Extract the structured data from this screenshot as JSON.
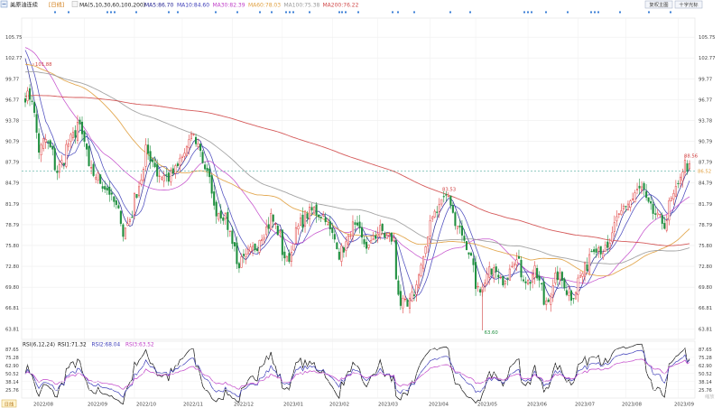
{
  "header": {
    "name": "美原油连续",
    "period_tag": "[日线]",
    "ma_params": "MA(5,10,30,60,100,200)",
    "ma_values": [
      {
        "label": "MA5:86.70",
        "color": "#1f1f8f"
      },
      {
        "label": "MA10:84.60",
        "color": "#3b3bb8"
      },
      {
        "label": "MA30:82.39",
        "color": "#c040c8"
      },
      {
        "label": "MA60:78.03",
        "color": "#e0a040"
      },
      {
        "label": "MA100:75.38",
        "color": "#9a9a9a"
      },
      {
        "label": "MA200:76.22",
        "color": "#d04848"
      }
    ],
    "buttons": [
      "复权主图",
      "十字光标"
    ]
  },
  "y_ticks": [
    "105.75",
    "102.77",
    "99.77",
    "96.77",
    "93.78",
    "90.79",
    "87.79",
    "84.79",
    "81.79",
    "78.79",
    "75.80",
    "72.80",
    "69.80",
    "66.81",
    "63.81"
  ],
  "rsi_ticks": [
    "87.65",
    "75.28",
    "62.90",
    "50.52",
    "38.14",
    "25.76"
  ],
  "x_ticks": [
    "2022/08",
    "2022/09",
    "2022/10",
    "2022/11",
    "2022/12",
    "2023/01",
    "2023/02",
    "2023/03",
    "2023/04",
    "2023/05",
    "2023/06",
    "2023/07",
    "2023/08",
    "2023/09"
  ],
  "annotations": {
    "high_start": "101.88",
    "high_mid": "83.53",
    "low": "63.60",
    "high_end": "88.56",
    "last_price": "86.52"
  },
  "rsi_header": {
    "params": "RSI(6,12,24)",
    "values": [
      {
        "label": "RSI1:71.32",
        "color": "#111111"
      },
      {
        "label": "RSI2:68.04",
        "color": "#3b3bb8"
      },
      {
        "label": "RSI3:63.52",
        "color": "#c040c8"
      }
    ]
  },
  "footer": {
    "period": "日线",
    "zoom": "缩放"
  },
  "colors": {
    "up": "#e04040",
    "down": "#1f8f3f",
    "grid": "#eeeeee",
    "last_line": "#2a9a8a",
    "accent": "#e0a040"
  },
  "chart_data": {
    "type": "candlestick",
    "title": "美原油连续",
    "x_range": [
      "2022/08",
      "2023/09"
    ],
    "ylim": [
      62.3,
      108.5
    ],
    "rsi_ylim": [
      13,
      100
    ],
    "anchors": [
      [
        "2022/07/27",
        97.3
      ],
      [
        "2022/08/01",
        97.0
      ],
      [
        "2022/08/04",
        89.5
      ],
      [
        "2022/08/09",
        91.0
      ],
      [
        "2022/08/16",
        86.5
      ],
      [
        "2022/08/22",
        90.0
      ],
      [
        "2022/08/29",
        93.5
      ],
      [
        "2022/09/05",
        86.5
      ],
      [
        "2022/09/12",
        85.0
      ],
      [
        "2022/09/20",
        82.0
      ],
      [
        "2022/09/26",
        77.5
      ],
      [
        "2022/10/03",
        82.5
      ],
      [
        "2022/10/10",
        89.5
      ],
      [
        "2022/10/17",
        86.0
      ],
      [
        "2022/10/24",
        85.5
      ],
      [
        "2022/11/01",
        88.5
      ],
      [
        "2022/11/07",
        92.0
      ],
      [
        "2022/11/14",
        88.0
      ],
      [
        "2022/11/21",
        81.0
      ],
      [
        "2022/11/28",
        79.5
      ],
      [
        "2022/12/05",
        73.0
      ],
      [
        "2022/12/12",
        74.5
      ],
      [
        "2022/12/19",
        77.0
      ],
      [
        "2022/12/26",
        80.0
      ],
      [
        "2023/01/04",
        73.5
      ],
      [
        "2023/01/12",
        79.0
      ],
      [
        "2023/01/20",
        81.0
      ],
      [
        "2023/01/27",
        80.0
      ],
      [
        "2023/02/06",
        74.5
      ],
      [
        "2023/02/14",
        78.5
      ],
      [
        "2023/02/23",
        75.5
      ],
      [
        "2023/03/02",
        78.0
      ],
      [
        "2023/03/10",
        76.5
      ],
      [
        "2023/03/15",
        67.5
      ],
      [
        "2023/03/20",
        66.8
      ],
      [
        "2023/03/28",
        73.0
      ],
      [
        "2023/04/04",
        80.5
      ],
      [
        "2023/04/12",
        83.0
      ],
      [
        "2023/04/18",
        79.5
      ],
      [
        "2023/04/26",
        75.0
      ],
      [
        "2023/05/03",
        68.5
      ],
      [
        "2023/05/10",
        72.5
      ],
      [
        "2023/05/16",
        70.5
      ],
      [
        "2023/05/24",
        74.0
      ],
      [
        "2023/06/01",
        70.5
      ],
      [
        "2023/06/06",
        72.0
      ],
      [
        "2023/06/12",
        67.5
      ],
      [
        "2023/06/20",
        71.5
      ],
      [
        "2023/06/28",
        68.5
      ],
      [
        "2023/07/05",
        71.8
      ],
      [
        "2023/07/12",
        75.8
      ],
      [
        "2023/07/20",
        75.0
      ],
      [
        "2023/07/28",
        80.5
      ],
      [
        "2023/08/04",
        82.5
      ],
      [
        "2023/08/10",
        84.0
      ],
      [
        "2023/08/17",
        80.5
      ],
      [
        "2023/08/24",
        79.0
      ],
      [
        "2023/08/31",
        83.5
      ],
      [
        "2023/09/06",
        87.5
      ],
      [
        "2023/09/09",
        86.5
      ]
    ],
    "ma_final": {
      "MA5": 86.7,
      "MA10": 84.6,
      "MA30": 82.39,
      "MA60": 78.03,
      "MA100": 75.38,
      "MA200": 76.22
    },
    "rsi_final": {
      "RSI1": 71.32,
      "RSI2": 68.04,
      "RSI3": 63.52
    }
  }
}
